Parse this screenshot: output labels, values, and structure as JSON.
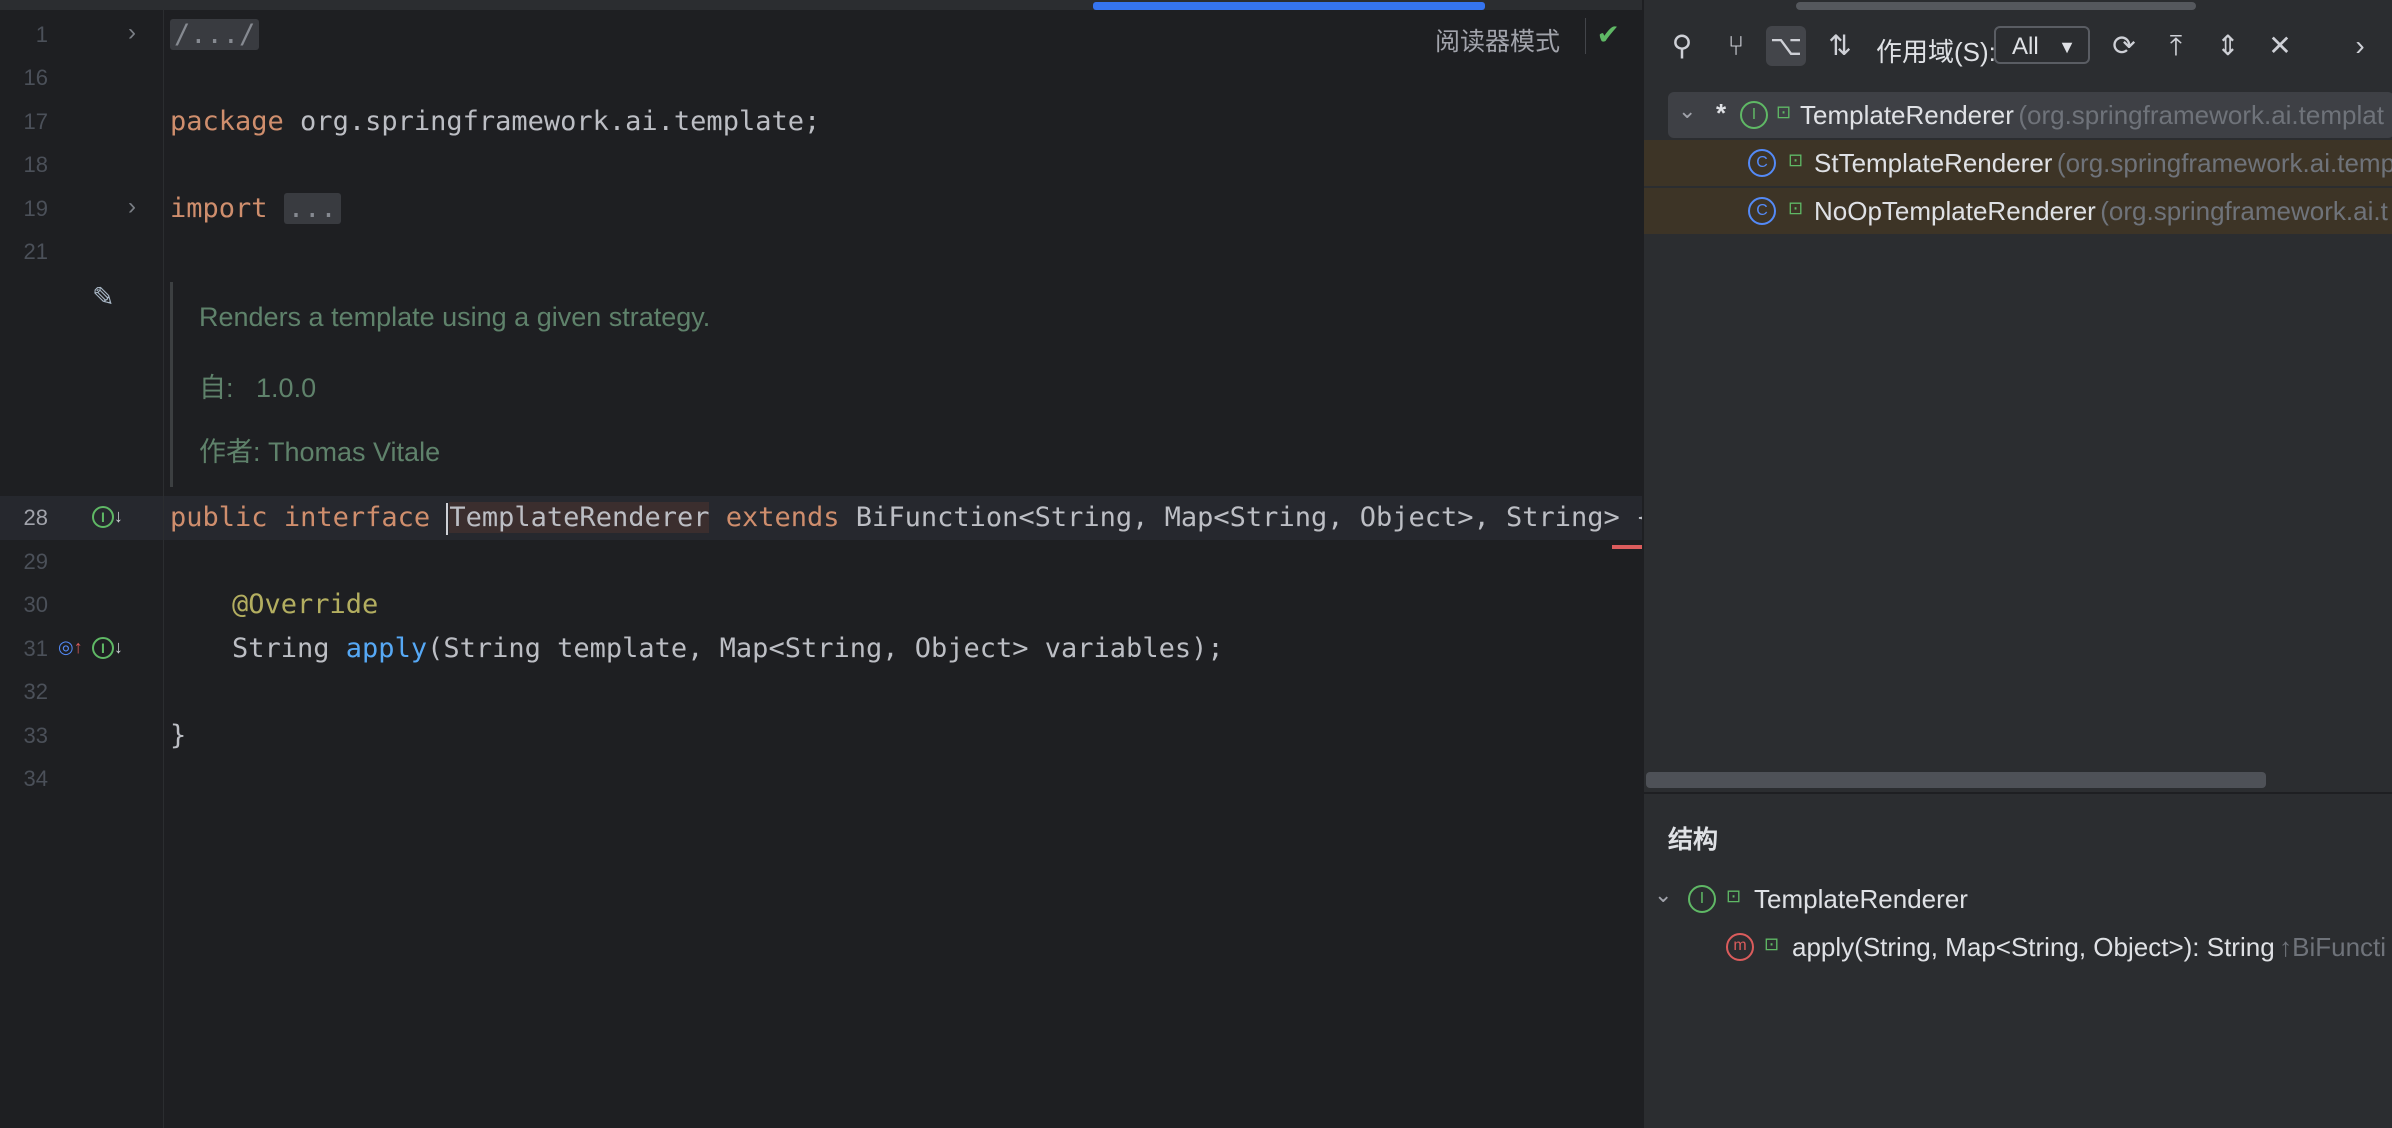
{
  "editor": {
    "reader_mode": "阅读器模式",
    "line_numbers": [
      "1",
      "16",
      "17",
      "18",
      "19",
      "21",
      "28",
      "29",
      "30",
      "31",
      "32",
      "33",
      "34"
    ],
    "lines": {
      "l1": "/.../",
      "l17_kw": "package",
      "l17_rest": " org.springframework.ai.template;",
      "l19_kw": "import",
      "l19_fold": "...",
      "l28_kw1": "public",
      "l28_kw2": "interface",
      "l28_name": "TemplateRenderer",
      "l28_kw3": "extends",
      "l28_rest": " BiFunction<String, Map<String, Object>, String> {",
      "l30_ann": "@Override",
      "l31_pre": "String ",
      "l31_fn": "apply",
      "l31_rest": "(String template, Map<String, Object> variables);",
      "l33": "}"
    },
    "doc": {
      "summary": "Renders a template using a given strategy.",
      "since_label": "自:",
      "since_value": "1.0.0",
      "author": "作者: Thomas Vitale"
    }
  },
  "hierarchy": {
    "scope_label": "作用域(S):",
    "scope_value": "All",
    "root": {
      "marker": "*",
      "name": "TemplateRenderer",
      "pkg": "(org.springframework.ai.templat"
    },
    "children": [
      {
        "name": "StTemplateRenderer",
        "pkg": "(org.springframework.ai.temp"
      },
      {
        "name": "NoOpTemplateRenderer",
        "pkg": "(org.springframework.ai.t"
      }
    ]
  },
  "structure": {
    "title": "结构",
    "root": "TemplateRenderer",
    "method": "apply(String, Map<String, Object>): String",
    "method_suffix": "↑BiFuncti"
  },
  "colors": {
    "accent": "#3574f0",
    "keyword": "#cf8e6d",
    "annotation": "#b3ae60",
    "function": "#56a8f5",
    "doc": "#5f826b"
  }
}
